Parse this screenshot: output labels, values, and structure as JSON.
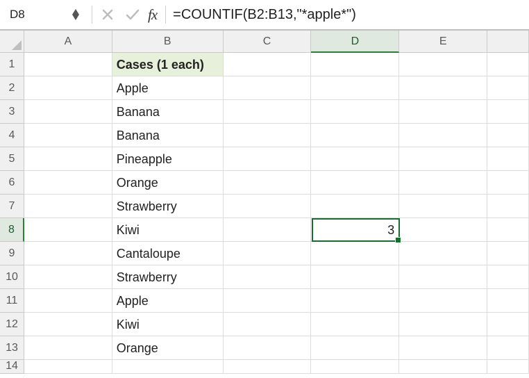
{
  "nameBox": "D8",
  "formula": "=COUNTIF(B2:B13,\"*apple*\")",
  "fxLabel": "fx",
  "columns": [
    "A",
    "B",
    "C",
    "D",
    "E",
    ""
  ],
  "rows": [
    "1",
    "2",
    "3",
    "4",
    "5",
    "6",
    "7",
    "8",
    "9",
    "10",
    "11",
    "12",
    "13",
    "14"
  ],
  "activeCol": "D",
  "activeRow": "8",
  "b1": "Cases (1 each)",
  "bvals": [
    "Apple",
    "Banana",
    "Banana",
    "Pineapple",
    "Orange",
    "Strawberry",
    "Kiwi",
    "Cantaloupe",
    "Strawberry",
    "Apple",
    "Kiwi",
    "Orange"
  ],
  "d8": "3"
}
